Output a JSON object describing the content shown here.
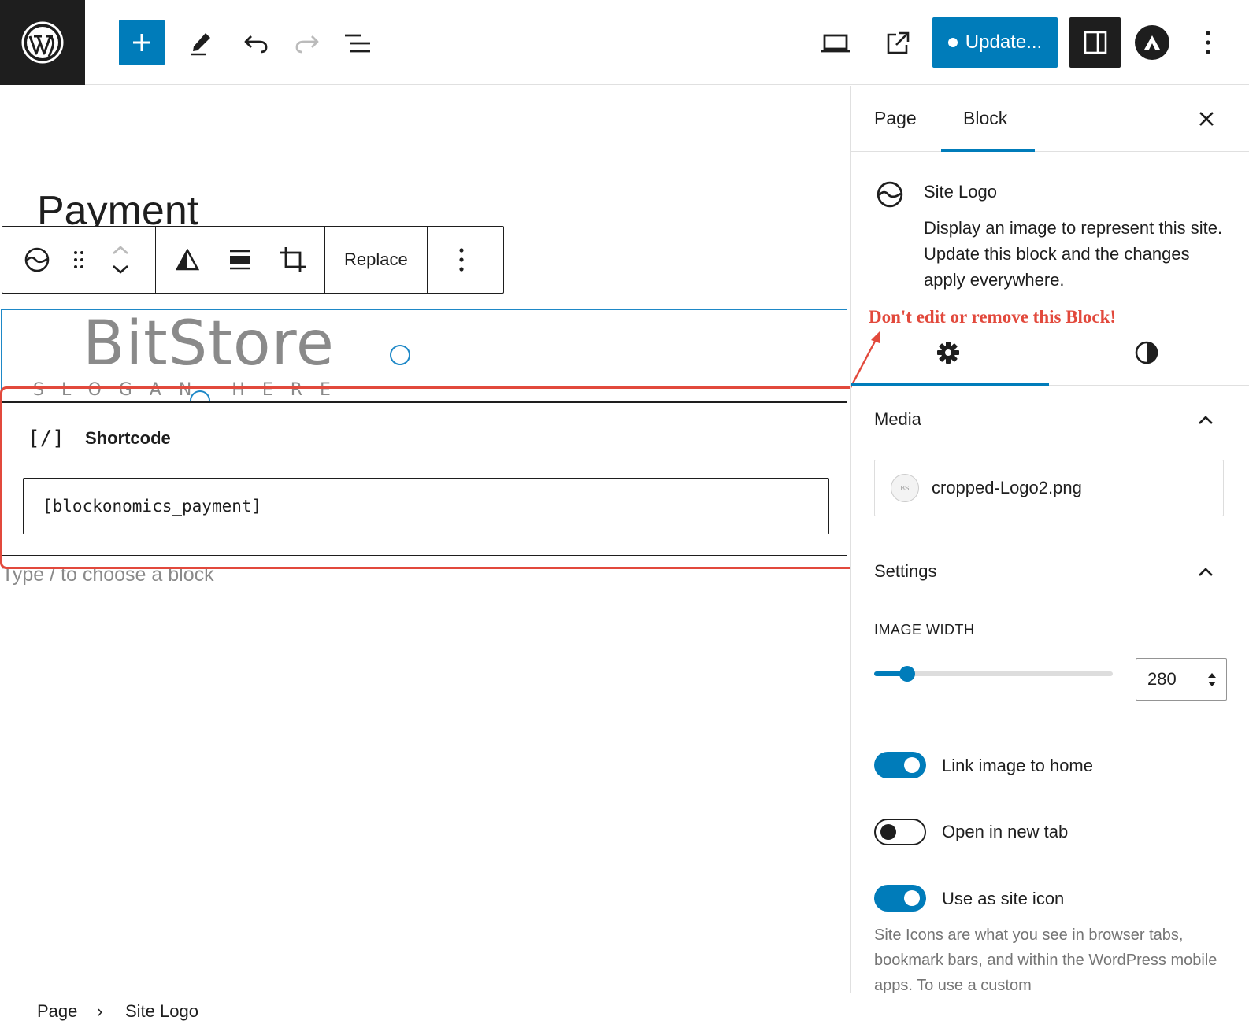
{
  "topbar": {
    "update_label": "Update...",
    "icons": [
      "wordpress-logo-icon",
      "plus-icon",
      "pencil-icon",
      "undo-icon",
      "redo-icon",
      "list-view-icon",
      "desktop-icon",
      "external-link-icon",
      "sidebar-icon",
      "astra-icon",
      "more-vertical-icon"
    ]
  },
  "editor": {
    "page_title": "Payment",
    "block_toolbar": {
      "replace_label": "Replace",
      "icons": [
        "site-logo-icon",
        "drag-handle-icon",
        "move-up-icon",
        "move-down-icon",
        "duotone-icon",
        "align-icon",
        "crop-icon",
        "more-vertical-icon"
      ]
    },
    "logo": {
      "text": "BitStore",
      "slogan": "SLOGAN HERE"
    },
    "shortcode_block": {
      "icon_text": "[/]",
      "label": "Shortcode",
      "value": "[blockonomics_payment]"
    },
    "placeholder": "Type / to choose a block"
  },
  "sidebar": {
    "tabs": [
      "Page",
      "Block"
    ],
    "active_tab": "Block",
    "block_card": {
      "title": "Site Logo",
      "description": "Display an image to represent this site. Update this block and the changes apply everywhere."
    },
    "annotation": "Don't edit or remove this Block!",
    "sub_tabs": [
      "settings-icon",
      "styles-icon"
    ],
    "media": {
      "title": "Media",
      "file_name": "cropped-Logo2.png"
    },
    "settings": {
      "title": "Settings",
      "image_width_label": "IMAGE WIDTH",
      "image_width_value": "280",
      "slider_fraction": 0.14,
      "toggles": [
        {
          "label": "Link image to home",
          "on": true
        },
        {
          "label": "Open in new tab",
          "on": false
        },
        {
          "label": "Use as site icon",
          "on": true
        }
      ],
      "help_text": "Site Icons are what you see in browser tabs, bookmark bars, and within the WordPress mobile apps. To use a custom"
    }
  },
  "breadcrumb": {
    "items": [
      "Page",
      "Site Logo"
    ],
    "separator": "›"
  },
  "colors": {
    "accent": "#007cba",
    "annotation": "#e2493c",
    "dark": "#1e1e1e",
    "muted": "#8a8a8a"
  }
}
